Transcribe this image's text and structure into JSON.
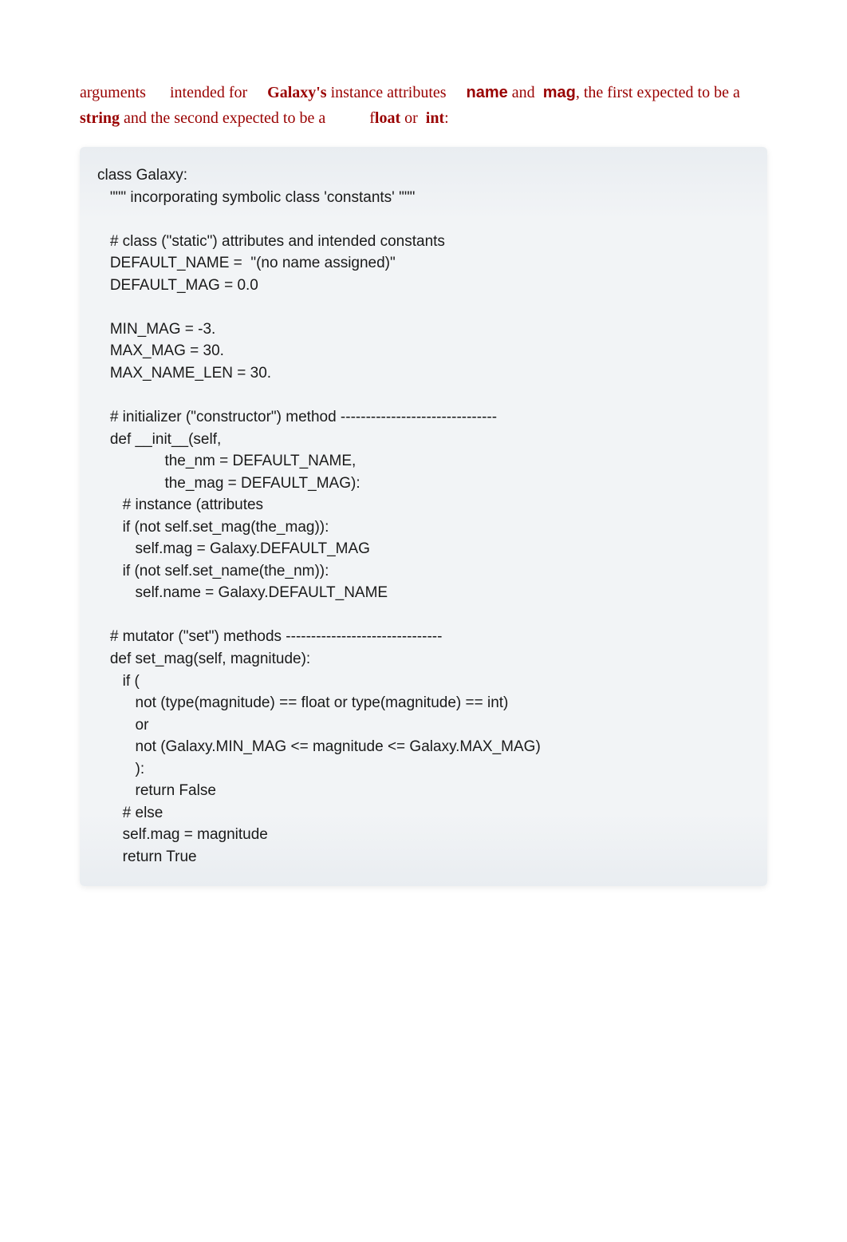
{
  "intro": {
    "t1": "arguments",
    "t2": "intended for ",
    "galaxy": "Galaxy's",
    "t3": " instance attributes ",
    "name_attr": "name",
    "t4": " and ",
    "mag_attr": "mag",
    "t5": ", the first expected to be a ",
    "string": "string",
    "t6": " and the second expected to be a ",
    "float_prefix": "f",
    "float_rest": "loat",
    "t7": " or ",
    "int": "int",
    "t8": ":"
  },
  "code": "class Galaxy:\n   \"\"\" incorporating symbolic class 'constants' \"\"\"\n\n   # class (\"static\") attributes and intended constants\n   DEFAULT_NAME =  \"(no name assigned)\"\n   DEFAULT_MAG = 0.0\n\n   MIN_MAG = -3.\n   MAX_MAG = 30.\n   MAX_NAME_LEN = 30.\n\n   # initializer (\"constructor\") method -------------------------------\n   def __init__(self,\n                the_nm = DEFAULT_NAME,\n                the_mag = DEFAULT_MAG):\n      # instance (attributes\n      if (not self.set_mag(the_mag)):\n         self.mag = Galaxy.DEFAULT_MAG\n      if (not self.set_name(the_nm)):\n         self.name = Galaxy.DEFAULT_NAME\n\n   # mutator (\"set\") methods -------------------------------\n   def set_mag(self, magnitude):\n      if (\n         not (type(magnitude) == float or type(magnitude) == int)\n         or\n         not (Galaxy.MIN_MAG <= magnitude <= Galaxy.MAX_MAG)\n         ):\n         return False\n      # else\n      self.mag = magnitude\n      return True"
}
